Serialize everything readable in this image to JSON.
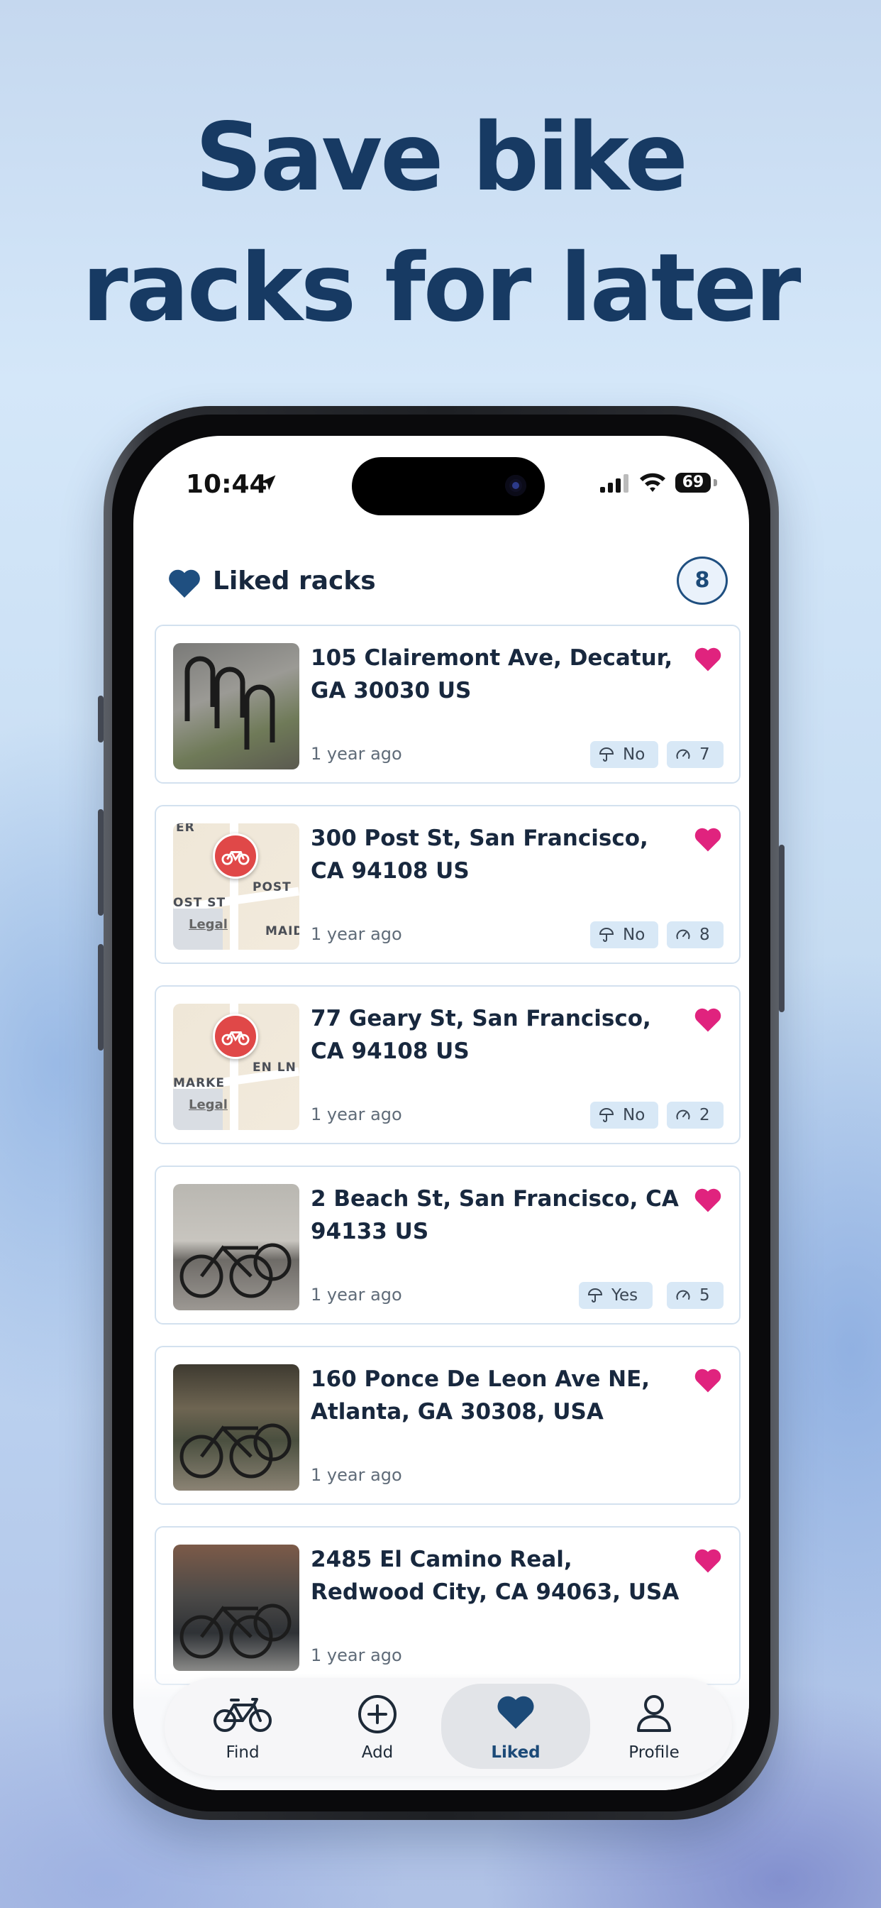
{
  "headline": {
    "line1": "Save bike",
    "line2": "racks for later"
  },
  "status_bar": {
    "time": "10:44",
    "battery": "69"
  },
  "header": {
    "title": "Liked racks",
    "count": "8"
  },
  "colors": {
    "brand": "#173a63",
    "accent_heart": "#e0237e",
    "tag_bg": "#d8e8f6"
  },
  "racks": [
    {
      "address": "105 Clairemont Ave, Decatur, GA 30030 US",
      "time": "1 year ago",
      "covered": "No",
      "capacity": "7",
      "thumb": "photo"
    },
    {
      "address": "300 Post St, San Francisco, CA 94108 US",
      "time": "1 year ago",
      "covered": "No",
      "capacity": "8",
      "thumb": "map",
      "map_labels": [
        "POST",
        "OST ST",
        "MAID",
        "ER",
        "Legal"
      ]
    },
    {
      "address": "77 Geary St, San Francisco, CA 94108 US",
      "time": "1 year ago",
      "covered": "No",
      "capacity": "2",
      "thumb": "map",
      "map_labels": [
        "EN LN",
        "MARKE",
        "Legal"
      ]
    },
    {
      "address": "2 Beach St, San Francisco, CA 94133 US",
      "time": "1 year ago",
      "covered": "Yes",
      "capacity": "5",
      "thumb": "photo"
    },
    {
      "address": "160 Ponce De Leon Ave NE, Atlanta, GA 30308, USA",
      "time": "1 year ago",
      "thumb": "photo"
    },
    {
      "address": "2485 El Camino Real, Redwood City, CA 94063, USA",
      "time": "1 year ago",
      "thumb": "photo"
    }
  ],
  "tabs": [
    {
      "label": "Find",
      "icon": "bicycle-icon"
    },
    {
      "label": "Add",
      "icon": "plus-circle-icon"
    },
    {
      "label": "Liked",
      "icon": "heart-icon",
      "active": true
    },
    {
      "label": "Profile",
      "icon": "person-icon"
    }
  ]
}
